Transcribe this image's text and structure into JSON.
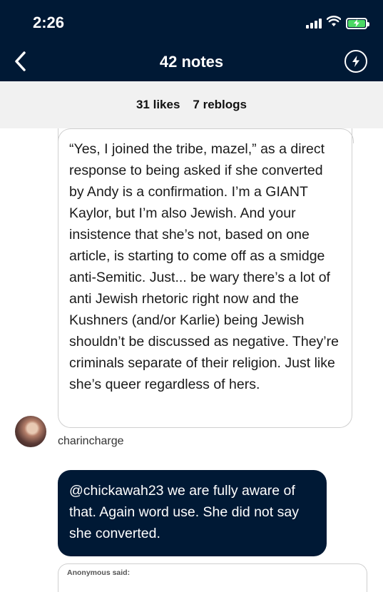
{
  "status_bar": {
    "time": "2:26",
    "battery_color": "#4cd964"
  },
  "header": {
    "title": "42 notes",
    "back_icon": "chevron-left-icon",
    "action_icon": "lightning-bolt-icon",
    "background": "#001935"
  },
  "tabs": {
    "likes": "31 likes",
    "reblogs": "7 reblogs"
  },
  "messages": [
    {
      "text": "“Yes, I joined the tribe, mazel,” as a direct response to being asked if she converted by Andy is a confirmation. I’m a GIANT Kaylor, but I’m also Jewish. And your insistence that she’s not, based on one article, is starting to come off as a smidge anti-Semitic. Just... be wary there’s a lot of anti Jewish rhetoric right now and the Kushners (and/or Karlie) being Jewish shouldn’t be discussed as negative. They’re criminals separate of their religion. Just like she’s queer regardless of hers."
    },
    {
      "username": "charincharge"
    },
    {
      "text": "@chickawah23 we are fully aware of that. Again word use. She did not say she converted."
    }
  ],
  "anon_card": {
    "label": "Anonymous said:"
  }
}
